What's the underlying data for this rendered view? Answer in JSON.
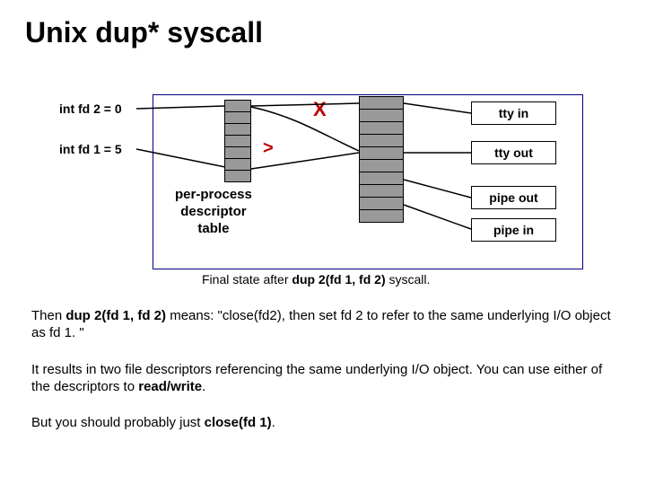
{
  "title": "Unix dup* syscall",
  "diagram": {
    "fd2_label": "int fd 2 = 0",
    "fd1_label": "int fd 1 = 5",
    "x_mark": "X",
    "chevron": ">",
    "table_label": "per-process\ndescriptor\ntable",
    "io": {
      "tty_in": "tty in",
      "tty_out": "tty out",
      "pipe_out": "pipe out",
      "pipe_in": "pipe in"
    },
    "caption_prefix": "Final state after ",
    "caption_bold": "dup 2(fd 1, fd 2)",
    "caption_suffix": " syscall."
  },
  "para1": {
    "t1": "Then ",
    "b1": "dup 2(fd 1, fd 2)",
    "t2": " means: \"close(fd2), then set fd 2 to refer to the same underlying I/O object as fd 1. \""
  },
  "para2": {
    "t1": "It results in two file descriptors referencing the same underlying I/O object. You can use either of the descriptors to ",
    "b1": "read/write",
    "t2": "."
  },
  "para3": {
    "t1": "But you should probably just ",
    "b1": "close(fd 1)",
    "t2": "."
  }
}
